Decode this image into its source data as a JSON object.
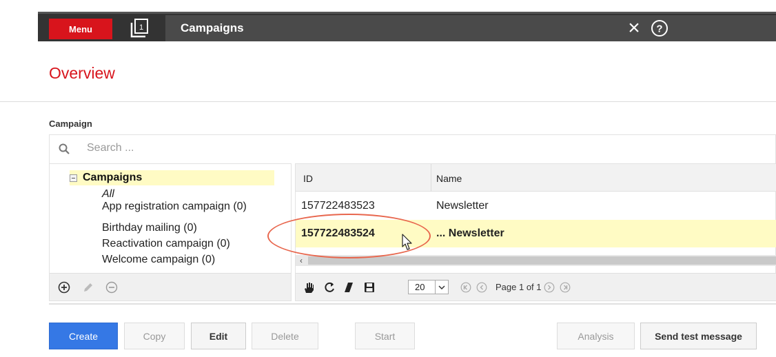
{
  "topbar": {
    "menu_label": "Menu",
    "window_count": "1",
    "title": "Campaigns"
  },
  "overview": {
    "title": "Overview"
  },
  "campaign_section": {
    "label": "Campaign",
    "search_placeholder": "Search ..."
  },
  "tree": {
    "root_label": "Campaigns",
    "items": [
      {
        "label": "All"
      },
      {
        "label": "App registration campaign (0)"
      },
      {
        "label": "Birthday mailing (0)"
      },
      {
        "label": "Reactivation campaign (0)"
      },
      {
        "label": "Welcome campaign (0)"
      }
    ],
    "toolbar_icons": [
      "add-icon",
      "edit-pencil-icon",
      "remove-icon"
    ]
  },
  "grid": {
    "columns": [
      "ID",
      "Name"
    ],
    "rows": [
      {
        "id": "157722483523",
        "name": "Newsletter",
        "selected": false
      },
      {
        "id": "157722483524",
        "name": "... Newsletter",
        "selected": true
      }
    ],
    "scroll_left_arrow": "‹",
    "page_size": "20",
    "page_info": "Page 1 of 1",
    "toolbar_icons": [
      "hand-icon",
      "refresh-icon",
      "eraser-icon",
      "save-icon",
      "first-page-icon",
      "prev-page-icon",
      "next-page-icon",
      "last-page-icon"
    ]
  },
  "buttons": {
    "create": "Create",
    "copy": "Copy",
    "edit": "Edit",
    "delete": "Delete",
    "start": "Start",
    "analysis": "Analysis",
    "send_test": "Send test message"
  },
  "colors": {
    "brand_red": "#d8141c",
    "topbar": "#333333",
    "selection": "#fffbc4",
    "primary_button": "#3578e5",
    "annotation": "#e8674e"
  }
}
